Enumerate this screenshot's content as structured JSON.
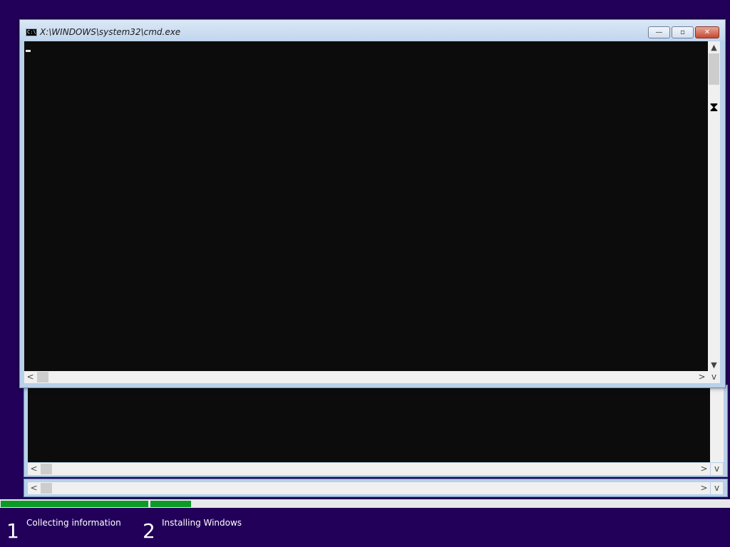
{
  "window": {
    "title": "X:\\WINDOWS\\system32\\cmd.exe",
    "icon_text": "C:\\",
    "minimize_glyph": "—",
    "maximize_glyph": "▫",
    "close_glyph": "✕"
  },
  "scrollbar": {
    "up_glyph": "▲",
    "down_glyph": "▼",
    "left_glyph": "<",
    "right_glyph": ">",
    "corner_glyph": "v"
  },
  "cursor_icon": "hourglass-icon",
  "setup": {
    "step1": {
      "number": "1",
      "label": "Collecting information",
      "progress": 1.0
    },
    "step2": {
      "number": "2",
      "label": "Installing Windows",
      "progress": 0.07
    }
  },
  "colors": {
    "desktop": "#22005a",
    "progress": "#0c9a26",
    "console": "#0c0c0c"
  }
}
